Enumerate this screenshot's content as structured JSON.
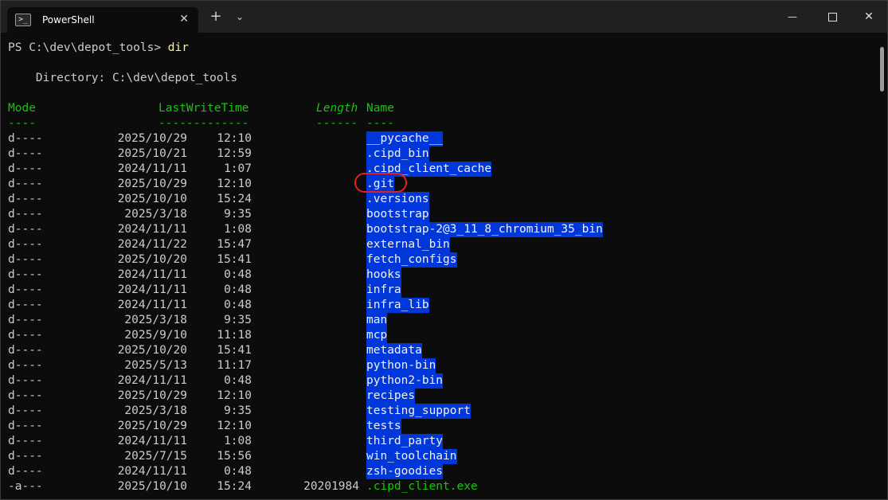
{
  "tab": {
    "title": "PowerShell",
    "close": "✕"
  },
  "titlebar": {
    "new_tab": "+",
    "dropdown": "⌄",
    "minimize": "—",
    "close": "✕"
  },
  "prompt": {
    "text": "PS C:\\dev\\depot_tools> ",
    "command": "dir"
  },
  "directory": "    Directory: C:\\dev\\depot_tools",
  "headers": {
    "mode": "Mode",
    "lastwrite": "LastWriteTime",
    "length": "Length",
    "name": "Name",
    "mode_ul": "----",
    "lastwrite_ul": "-------------",
    "length_ul": "------",
    "name_ul": "----"
  },
  "rows": [
    {
      "mode": "d----",
      "date": "2025/10/29",
      "time": "12:10",
      "length": "",
      "name": "__pycache__"
    },
    {
      "mode": "d----",
      "date": "2025/10/21",
      "time": "12:59",
      "length": "",
      "name": ".cipd_bin"
    },
    {
      "mode": "d----",
      "date": "2024/11/11",
      "time": "1:07",
      "length": "",
      "name": ".cipd_client_cache"
    },
    {
      "mode": "d----",
      "date": "2025/10/29",
      "time": "12:10",
      "length": "",
      "name": ".git"
    },
    {
      "mode": "d----",
      "date": "2025/10/10",
      "time": "15:24",
      "length": "",
      "name": ".versions"
    },
    {
      "mode": "d----",
      "date": "2025/3/18",
      "time": "9:35",
      "length": "",
      "name": "bootstrap"
    },
    {
      "mode": "d----",
      "date": "2024/11/11",
      "time": "1:08",
      "length": "",
      "name": "bootstrap-2@3_11_8_chromium_35_bin"
    },
    {
      "mode": "d----",
      "date": "2024/11/22",
      "time": "15:47",
      "length": "",
      "name": "external_bin"
    },
    {
      "mode": "d----",
      "date": "2025/10/20",
      "time": "15:41",
      "length": "",
      "name": "fetch_configs"
    },
    {
      "mode": "d----",
      "date": "2024/11/11",
      "time": "0:48",
      "length": "",
      "name": "hooks"
    },
    {
      "mode": "d----",
      "date": "2024/11/11",
      "time": "0:48",
      "length": "",
      "name": "infra"
    },
    {
      "mode": "d----",
      "date": "2024/11/11",
      "time": "0:48",
      "length": "",
      "name": "infra_lib"
    },
    {
      "mode": "d----",
      "date": "2025/3/18",
      "time": "9:35",
      "length": "",
      "name": "man"
    },
    {
      "mode": "d----",
      "date": "2025/9/10",
      "time": "11:18",
      "length": "",
      "name": "mcp"
    },
    {
      "mode": "d----",
      "date": "2025/10/20",
      "time": "15:41",
      "length": "",
      "name": "metadata"
    },
    {
      "mode": "d----",
      "date": "2025/5/13",
      "time": "11:17",
      "length": "",
      "name": "python-bin"
    },
    {
      "mode": "d----",
      "date": "2024/11/11",
      "time": "0:48",
      "length": "",
      "name": "python2-bin"
    },
    {
      "mode": "d----",
      "date": "2025/10/29",
      "time": "12:10",
      "length": "",
      "name": "recipes"
    },
    {
      "mode": "d----",
      "date": "2025/3/18",
      "time": "9:35",
      "length": "",
      "name": "testing_support"
    },
    {
      "mode": "d----",
      "date": "2025/10/29",
      "time": "12:10",
      "length": "",
      "name": "tests"
    },
    {
      "mode": "d----",
      "date": "2024/11/11",
      "time": "1:08",
      "length": "",
      "name": "third_party"
    },
    {
      "mode": "d----",
      "date": "2025/7/15",
      "time": "15:56",
      "length": "",
      "name": "win_toolchain"
    },
    {
      "mode": "d----",
      "date": "2024/11/11",
      "time": "0:48",
      "length": "",
      "name": "zsh-goodies"
    },
    {
      "mode": "-a---",
      "date": "2025/10/10",
      "time": "15:24",
      "length": "20201984",
      "name": ".cipd_client.exe"
    }
  ],
  "colors": {
    "background": "#0c0c0c",
    "selection": "#0037da",
    "header_green": "#16c60c",
    "command_yellow": "#f9f1a5",
    "annotation_ring": "#e02020"
  },
  "icons": {
    "tab": "powershell-icon"
  }
}
